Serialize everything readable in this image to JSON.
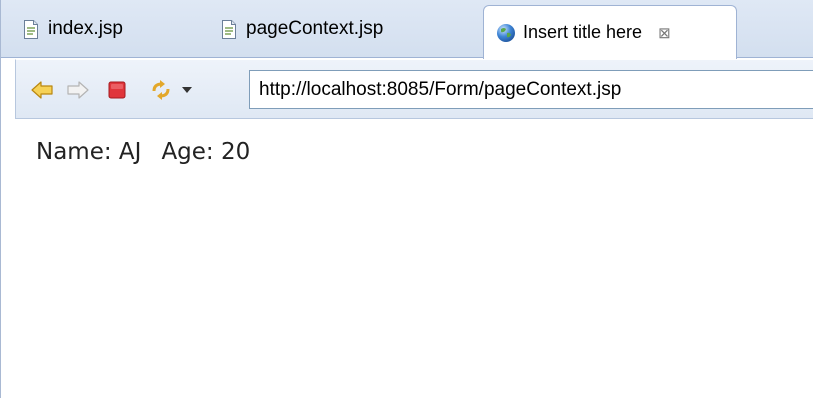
{
  "tabs": [
    {
      "label": "index.jsp",
      "icon": "jsp-file-icon",
      "active": false
    },
    {
      "label": "pageContext.jsp",
      "icon": "jsp-file-icon",
      "active": false
    },
    {
      "label": "Insert title here",
      "icon": "globe-icon",
      "active": true
    }
  ],
  "tab_close_glyph": "⊠",
  "toolbar": {
    "back_icon": "back-arrow-icon",
    "forward_icon": "forward-arrow-icon",
    "stop_icon": "stop-icon",
    "refresh_icon": "refresh-icon",
    "dropdown_icon": "dropdown-triangle-icon",
    "url": "http://localhost:8085/Form/pageContext.jsp"
  },
  "page": {
    "name_text": "Name: AJ",
    "age_text": "Age: 20"
  },
  "colors": {
    "tab_bar": "#d8e3f2",
    "toolbar": "#e6eef8",
    "back_arrow": "#f2c335",
    "stop": "#e0353b"
  }
}
